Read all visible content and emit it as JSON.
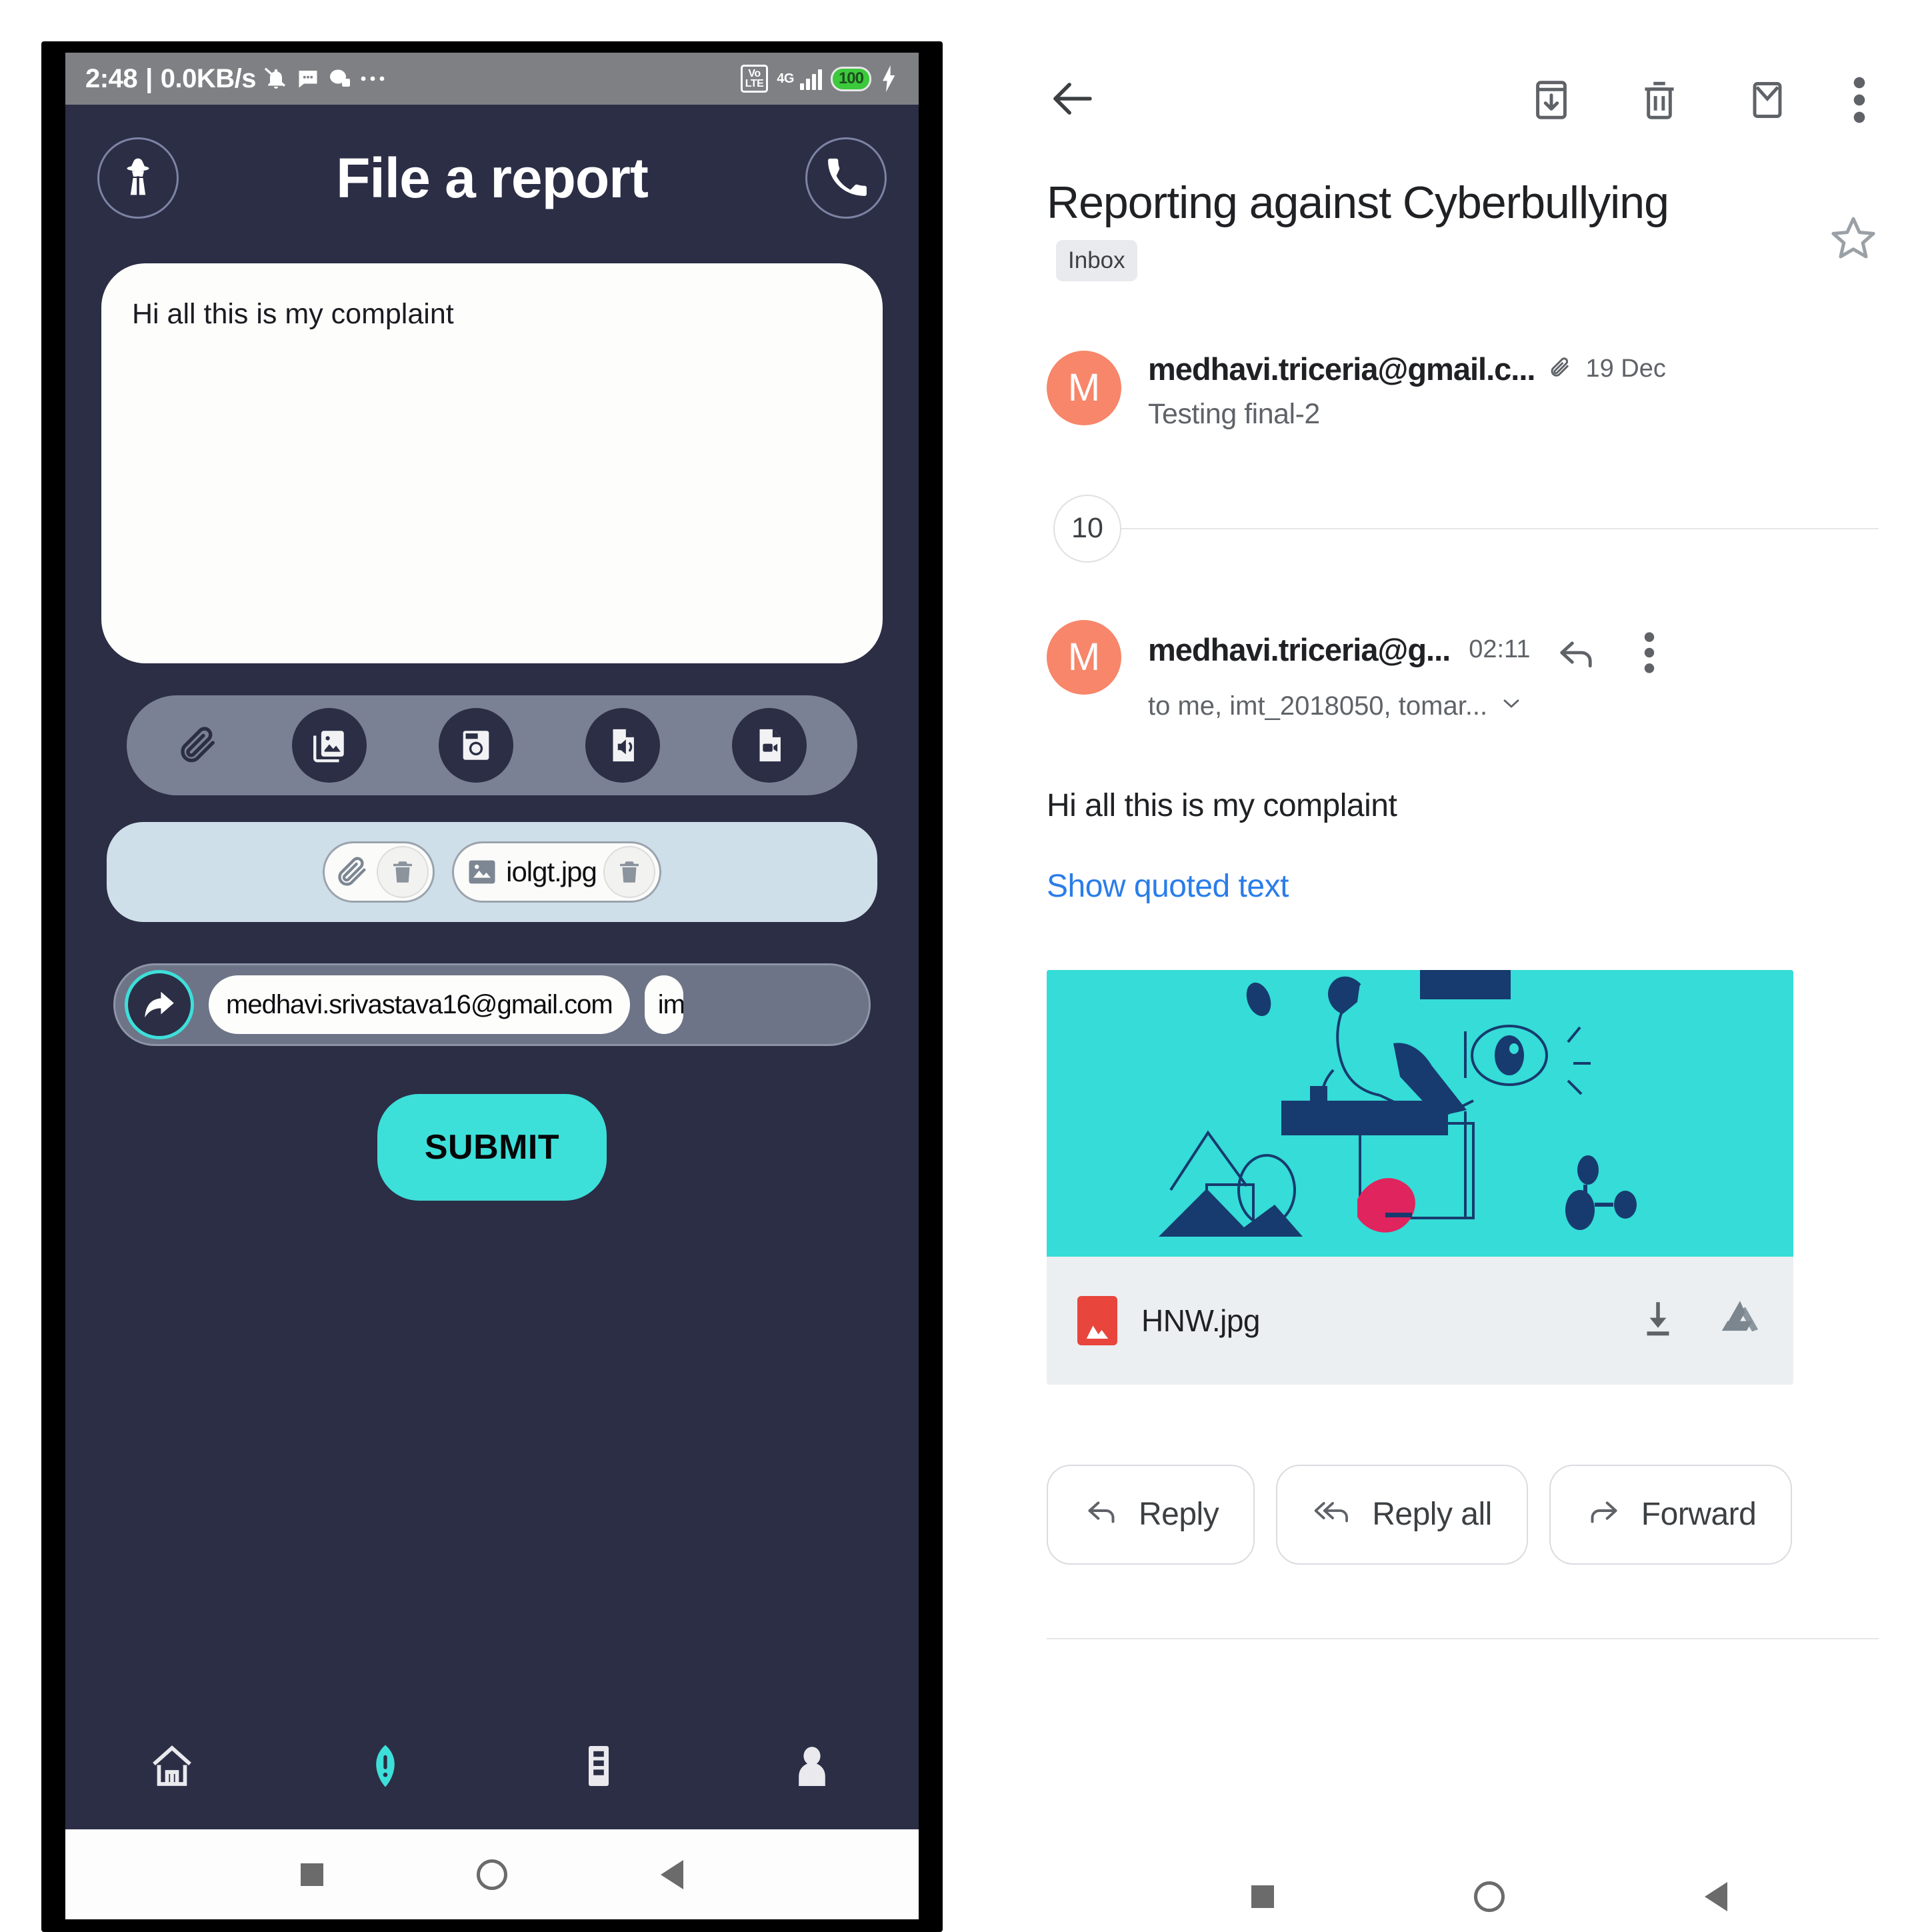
{
  "phone": {
    "status_bar": {
      "time": "2:48",
      "separator": "|",
      "net_speed": "0.0KB/s",
      "icons": [
        "bell-off-icon",
        "chat-icon",
        "messenger-icon",
        "more-dots-icon"
      ],
      "volte_label_top": "Vo",
      "volte_label_bottom": "LTE",
      "network_type": "4G",
      "battery_level": "100",
      "charging": true
    },
    "header": {
      "left_icon": "spy-detective-icon",
      "title": "File a report",
      "right_icon": "phone-call-icon"
    },
    "compose": {
      "text": "Hi all this is my complaint"
    },
    "attach_bar": {
      "items": [
        {
          "icon": "paperclip-icon",
          "filled": false
        },
        {
          "icon": "gallery-images-icon",
          "filled": true
        },
        {
          "icon": "camera-icon",
          "filled": true
        },
        {
          "icon": "audio-file-icon",
          "filled": true
        },
        {
          "icon": "video-file-icon",
          "filled": true
        }
      ]
    },
    "attachments": [
      {
        "icon": "paperclip-icon",
        "name": "",
        "delete_icon": "trash-icon"
      },
      {
        "icon": "image-file-icon",
        "name": "iolgt.jpg",
        "delete_icon": "trash-icon"
      }
    ],
    "recipients": {
      "forward_icon": "forward-share-icon",
      "chips": [
        "medhavi.srivastava16@gmail.com",
        "im"
      ]
    },
    "submit_label": "SUBMIT",
    "bottom_nav": [
      {
        "icon": "home-icon",
        "active": false
      },
      {
        "icon": "report-alert-icon",
        "active": true
      },
      {
        "icon": "records-list-icon",
        "active": false
      },
      {
        "icon": "profile-person-icon",
        "active": false
      }
    ],
    "android_nav": [
      "recents-square-icon",
      "home-circle-icon",
      "back-triangle-icon"
    ]
  },
  "gmail": {
    "toolbar": {
      "back_icon": "back-arrow-icon",
      "archive_icon": "archive-icon",
      "delete_icon": "trash-icon",
      "unread_icon": "mark-unread-envelope-icon",
      "more_icon": "more-vertical-icon"
    },
    "subject": "Reporting against Cyberbullying",
    "label_chip": "Inbox",
    "star_icon": "star-outline-icon",
    "message_top": {
      "avatar_letter": "M",
      "sender": "medhavi.triceria@gmail.c...",
      "attachment_icon": "paperclip-icon",
      "date": "19 Dec",
      "snippet": "Testing final-2"
    },
    "collapsed_count": "10",
    "message_open": {
      "avatar_letter": "M",
      "sender": "medhavi.triceria@g...",
      "time": "02:11",
      "recipients": "to me, imt_2018050, tomar...",
      "expand_icon": "chevron-down-icon",
      "reply_icon": "reply-arrow-icon",
      "more_icon": "more-vertical-icon",
      "body": "Hi all this is my complaint",
      "quoted_link": "Show quoted text"
    },
    "attachment": {
      "file_name": "HNW.jpg",
      "type_icon": "image-file-icon",
      "download_icon": "download-icon",
      "drive_icon": "google-drive-icon",
      "preview_bg": "#35dcd8",
      "preview_ink": "#173b6e",
      "preview_accent": "#e0245e"
    },
    "reply_buttons": [
      {
        "label": "Reply",
        "icon": "reply-arrow-icon"
      },
      {
        "label": "Reply all",
        "icon": "reply-all-arrow-icon"
      },
      {
        "label": "Forward",
        "icon": "forward-arrow-icon"
      }
    ],
    "android_nav": [
      "recents-square-icon",
      "home-circle-icon",
      "back-triangle-icon"
    ]
  },
  "colors": {
    "app_bg": "#2b2e45",
    "accent_teal": "#3ddfd9",
    "gmail_link": "#2b7de9",
    "avatar": "#f7866a"
  }
}
